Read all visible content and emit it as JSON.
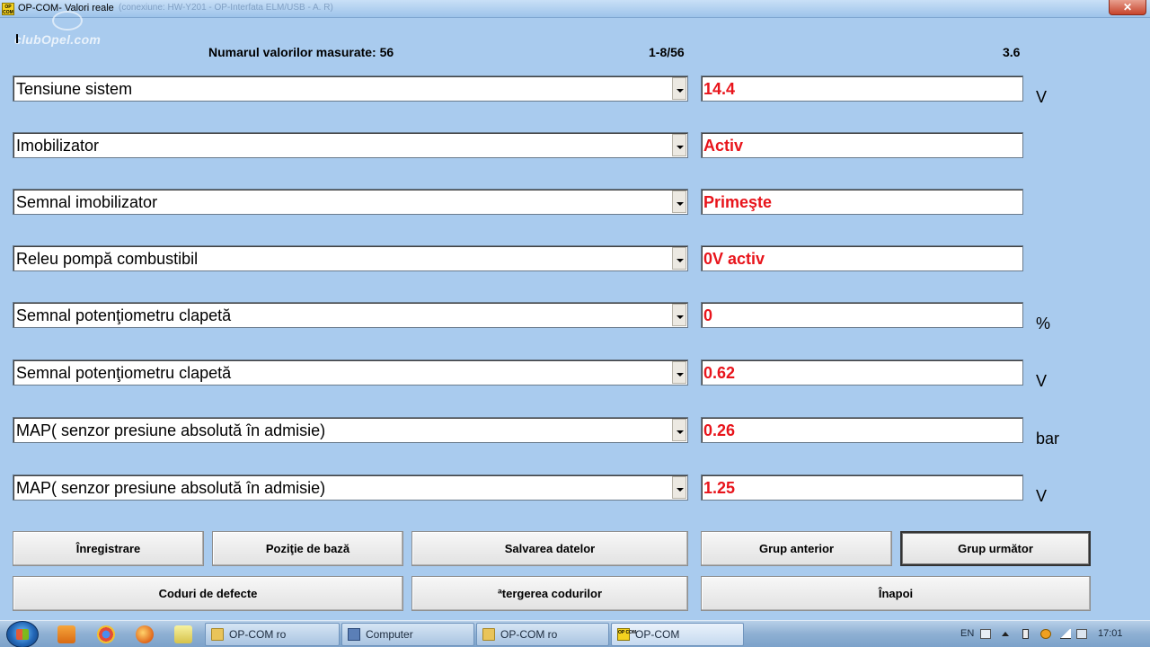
{
  "window": {
    "title": "OP-COM- Valori reale",
    "title_extra": "(conexiune: HW-Y201 - OP-Interfata ELM/USB - A. R)",
    "close_label": "✕",
    "app_icon_text": "OP COM"
  },
  "watermark": "clubOpel.com",
  "header": {
    "count_label": "Numarul valorilor masurate: 56",
    "range_label": "1-8/56",
    "version_label": "3.6"
  },
  "rows": [
    {
      "label": "Tensiune sistem",
      "value": "14.4",
      "unit": "V"
    },
    {
      "label": "Imobilizator",
      "value": "Activ",
      "unit": ""
    },
    {
      "label": "Semnal imobilizator",
      "value": "Primeşte",
      "unit": ""
    },
    {
      "label": "Releu pompă combustibil",
      "value": "0V activ",
      "unit": ""
    },
    {
      "label": "Semnal potenţiometru clapetă",
      "value": "0",
      "unit": "%"
    },
    {
      "label": "Semnal potenţiometru clapetă",
      "value": "0.62",
      "unit": "V"
    },
    {
      "label": "MAP( senzor presiune absolută în admisie)",
      "value": "0.26",
      "unit": "bar"
    },
    {
      "label": "MAP( senzor presiune absolută în admisie)",
      "value": "1.25",
      "unit": "V"
    }
  ],
  "buttons": {
    "record": "Înregistrare",
    "base_position": "Poziţie de bază",
    "save_data": "Salvarea datelor",
    "prev_group": "Grup anterior",
    "next_group": "Grup următor",
    "fault_codes": "Coduri de defecte",
    "clear_codes": "ªtergerea codurilor",
    "back": "Înapoi"
  },
  "taskbar": {
    "items": [
      "OP-COM ro",
      "Computer",
      "OP-COM ro",
      "OP-COM"
    ],
    "lang": "EN",
    "clock": "17:01"
  },
  "colors": {
    "background": "#a9cbee",
    "value_text": "#e8141b"
  }
}
